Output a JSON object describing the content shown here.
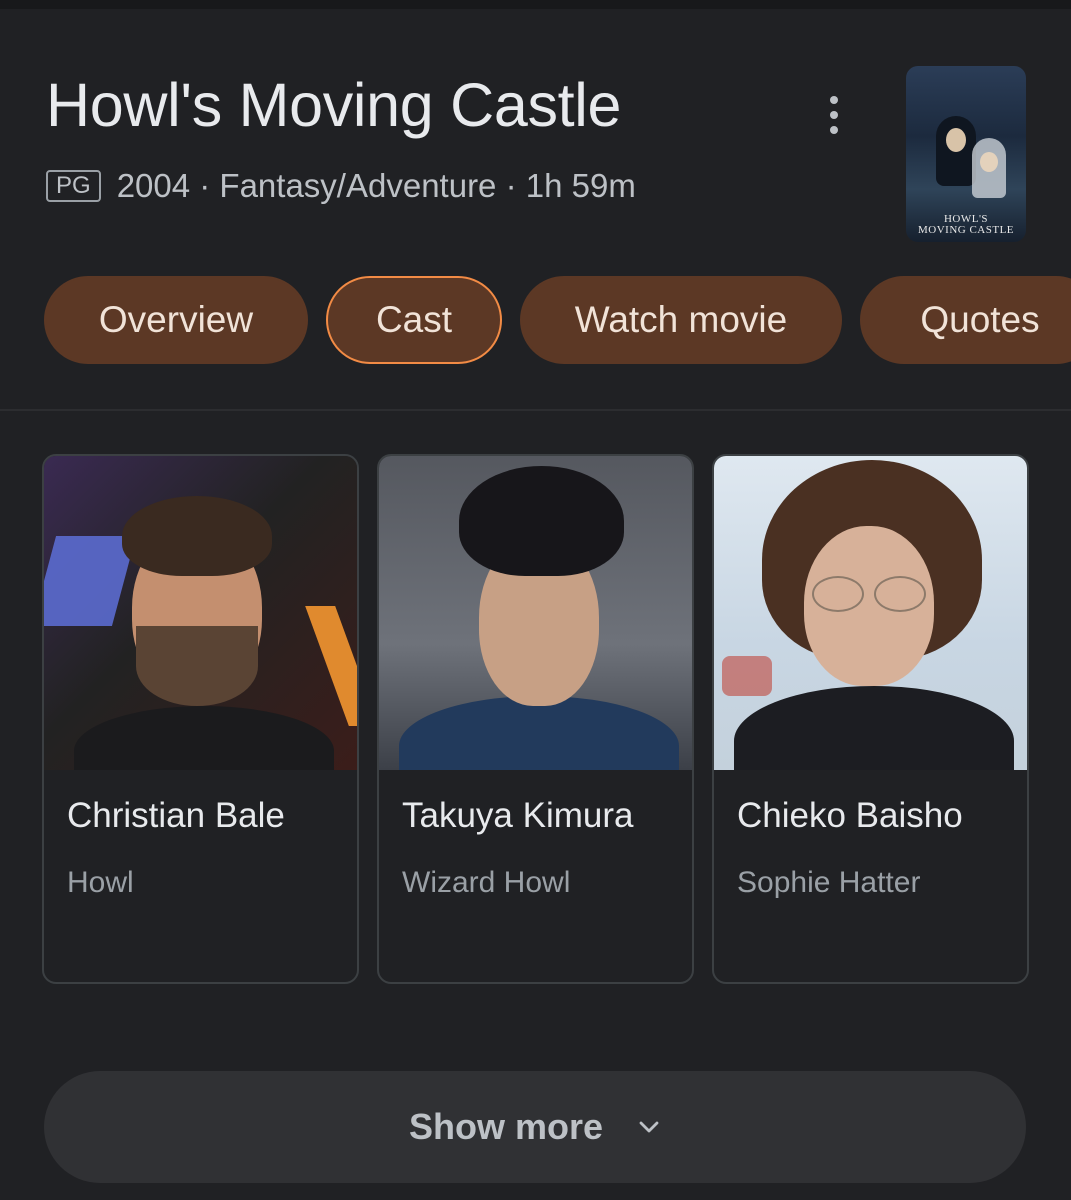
{
  "movie": {
    "title": "Howl's Moving Castle",
    "rating": "PG",
    "meta": "2004 · Fantasy/Adventure · 1h 59m",
    "poster_text": "Howl's Moving Castle"
  },
  "icons": {
    "menu": "more-vert-icon",
    "expand": "chevron-down-icon"
  },
  "tabs": [
    {
      "label": "Overview",
      "active": false
    },
    {
      "label": "Cast",
      "active": true
    },
    {
      "label": "Watch movie",
      "active": false
    },
    {
      "label": "Quotes",
      "active": false
    }
  ],
  "cast": [
    {
      "name": "Christian Bale",
      "role": "Howl"
    },
    {
      "name": "Takuya Kimura",
      "role": "Wizard Howl"
    },
    {
      "name": "Chieko Baisho",
      "role": "Sophie Hatter"
    }
  ],
  "show_more": {
    "label": "Show more"
  },
  "colors": {
    "background": "#202124",
    "tab_fill": "#5c3825",
    "tab_active_border": "#f28b45",
    "text_primary": "#e8eaed",
    "text_secondary": "#9aa0a6"
  }
}
